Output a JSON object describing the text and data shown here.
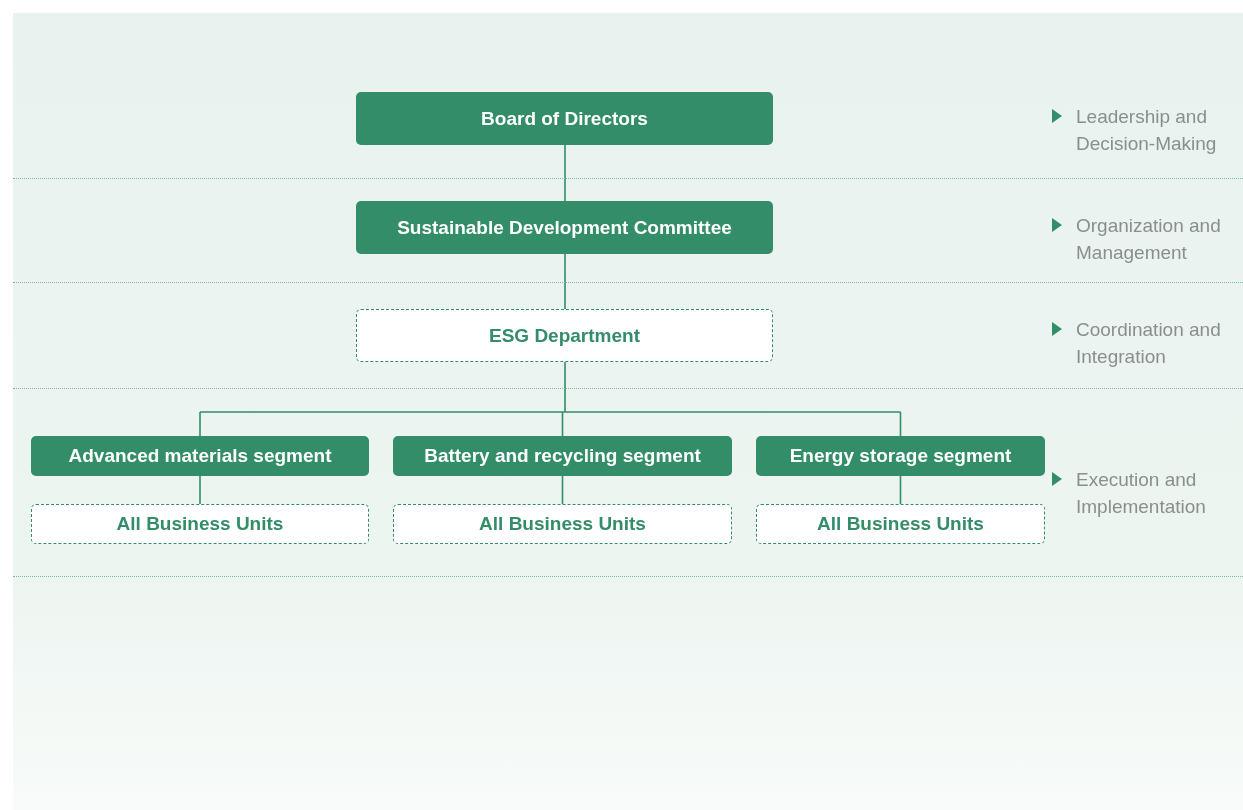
{
  "levels": [
    {
      "caption": "Leadership and Decision-Making",
      "nodes": [
        {
          "text": "Board of Directors",
          "kind": "solid"
        }
      ]
    },
    {
      "caption": "Organization and Management",
      "nodes": [
        {
          "text": "Sustainable Development Committee",
          "kind": "solid"
        }
      ]
    },
    {
      "caption": "Coordination and Integration",
      "nodes": [
        {
          "text": "ESG Department",
          "kind": "dashed"
        }
      ]
    },
    {
      "caption": "Execution and Implementation",
      "nodes": [
        {
          "text": "Advanced materials segment",
          "kind": "solid",
          "children": [
            {
              "text": "All Business Units",
              "kind": "dashed"
            }
          ]
        },
        {
          "text": "Battery and recycling segment",
          "kind": "solid",
          "children": [
            {
              "text": "All Business Units",
              "kind": "dashed"
            }
          ]
        },
        {
          "text": "Energy storage segment",
          "kind": "solid",
          "children": [
            {
              "text": "All Business Units",
              "kind": "dashed"
            }
          ]
        }
      ]
    }
  ]
}
